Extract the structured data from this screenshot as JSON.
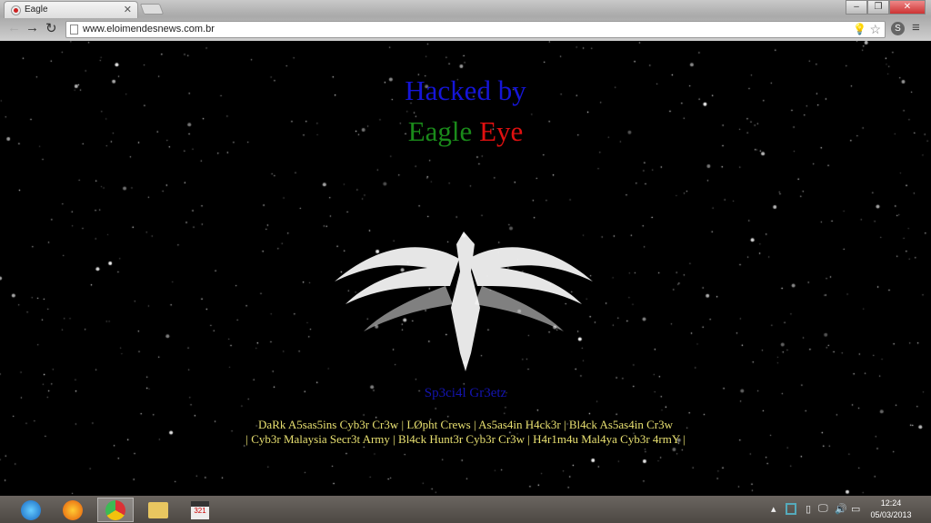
{
  "browser": {
    "tab_title": "Eagle",
    "url": "www.eloimendesnews.com.br"
  },
  "page": {
    "title_line1": "Hacked by",
    "title_word1": "Eagle",
    "title_word2": "Eye",
    "greetz_title": "Sp3ci4l Gr3etz",
    "greetz_line1": "DaRk A5sas5ins Cyb3r Cr3w | LØpht Crews | As5as4in H4ck3r | Bl4ck As5as4in Cr3w",
    "greetz_line2": "| Cyb3r Malaysia Secr3t Army | Bl4ck Hunt3r Cyb3r Cr3w | H4r1m4u Mal4ya Cyb3r 4rmY |",
    "colors": {
      "blue": "#1515d8",
      "green": "#1a8a1a",
      "red": "#e01010",
      "gold": "#e8e070"
    }
  },
  "taskbar": {
    "apps": [
      "internet-explorer",
      "firefox",
      "chrome",
      "file-explorer",
      "media-player-classic"
    ],
    "active": "chrome",
    "clock_time": "12:24",
    "clock_date": "05/03/2013"
  }
}
